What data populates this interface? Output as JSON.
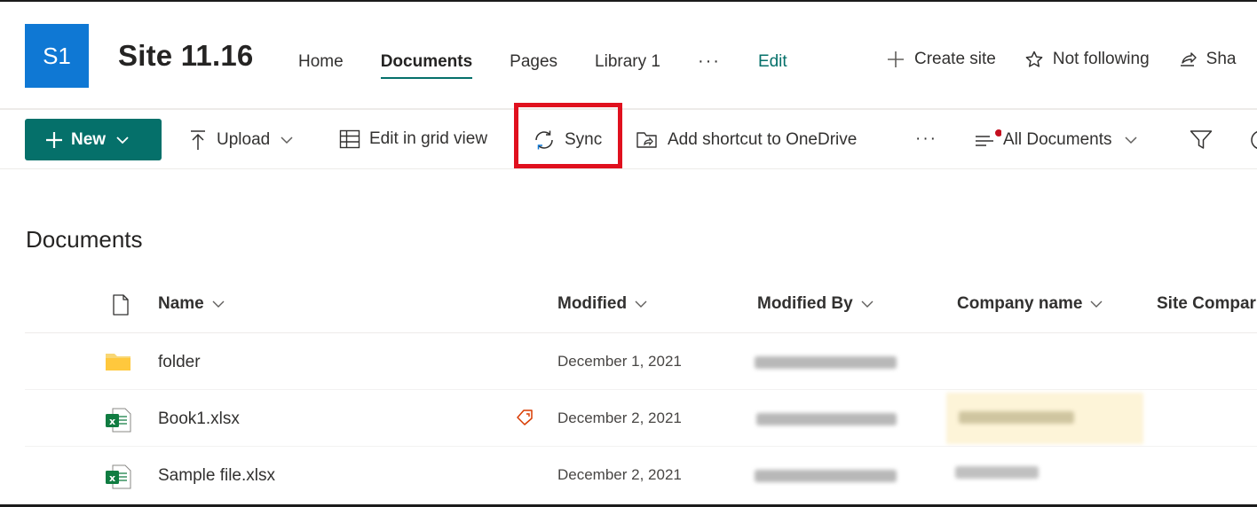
{
  "site": {
    "logo_text": "S1",
    "title": "Site 11.16",
    "nav": [
      "Home",
      "Documents",
      "Pages",
      "Library 1"
    ],
    "nav_more": "···",
    "edit": "Edit",
    "actions": {
      "create_site": "Create site",
      "not_following": "Not following",
      "share": "Sha"
    }
  },
  "commands": {
    "new": "New",
    "upload": "Upload",
    "grid_view": "Edit in grid view",
    "sync": "Sync",
    "shortcut": "Add shortcut to OneDrive",
    "more": "···",
    "view": "All Documents"
  },
  "library": {
    "title": "Documents",
    "columns": {
      "name": "Name",
      "modified": "Modified",
      "modified_by": "Modified By",
      "company": "Company name",
      "site_company": "Site Compar"
    },
    "rows": [
      {
        "name": "folder",
        "modified": "December 1, 2021",
        "type": "folder-icon"
      },
      {
        "name": "Book1.xlsx",
        "modified": "December 2, 2021",
        "type": "excel-icon"
      },
      {
        "name": "Sample file.xlsx",
        "modified": "December 2, 2021",
        "type": "excel-icon"
      }
    ]
  },
  "colors": {
    "accent": "#05706a",
    "logo": "#0f78d4",
    "highlight": "#e0101e"
  }
}
